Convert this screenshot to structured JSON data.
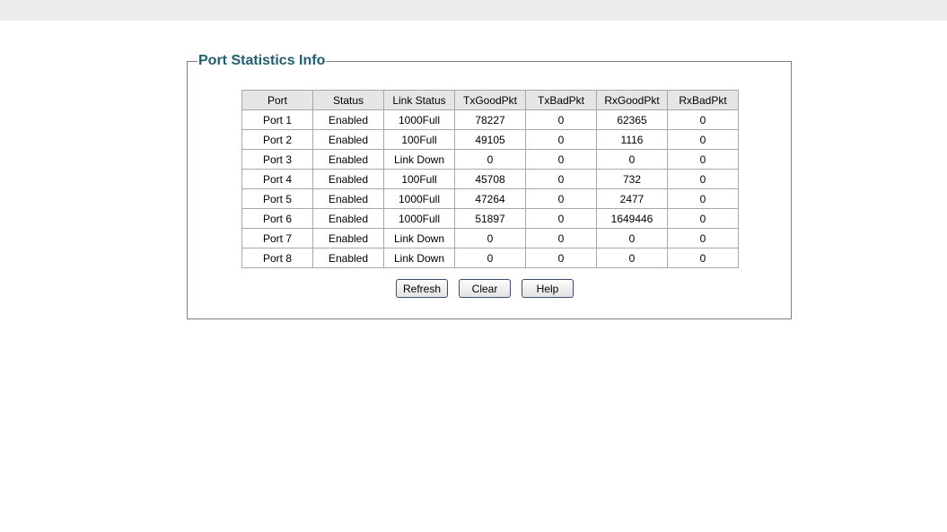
{
  "panel": {
    "title": "Port Statistics Info"
  },
  "table": {
    "headers": [
      "Port",
      "Status",
      "Link Status",
      "TxGoodPkt",
      "TxBadPkt",
      "RxGoodPkt",
      "RxBadPkt"
    ],
    "rows": [
      [
        "Port 1",
        "Enabled",
        "1000Full",
        "78227",
        "0",
        "62365",
        "0"
      ],
      [
        "Port 2",
        "Enabled",
        "100Full",
        "49105",
        "0",
        "1116",
        "0"
      ],
      [
        "Port 3",
        "Enabled",
        "Link Down",
        "0",
        "0",
        "0",
        "0"
      ],
      [
        "Port 4",
        "Enabled",
        "100Full",
        "45708",
        "0",
        "732",
        "0"
      ],
      [
        "Port 5",
        "Enabled",
        "1000Full",
        "47264",
        "0",
        "2477",
        "0"
      ],
      [
        "Port 6",
        "Enabled",
        "1000Full",
        "51897",
        "0",
        "1649446",
        "0"
      ],
      [
        "Port 7",
        "Enabled",
        "Link Down",
        "0",
        "0",
        "0",
        "0"
      ],
      [
        "Port 8",
        "Enabled",
        "Link Down",
        "0",
        "0",
        "0",
        "0"
      ]
    ]
  },
  "buttons": {
    "refresh": "Refresh",
    "clear": "Clear",
    "help": "Help"
  },
  "colors": {
    "title": "#1f5f6f",
    "header_bg": "#e6e6e6",
    "border": "#a8a8a8",
    "top_bar": "#ececec"
  }
}
